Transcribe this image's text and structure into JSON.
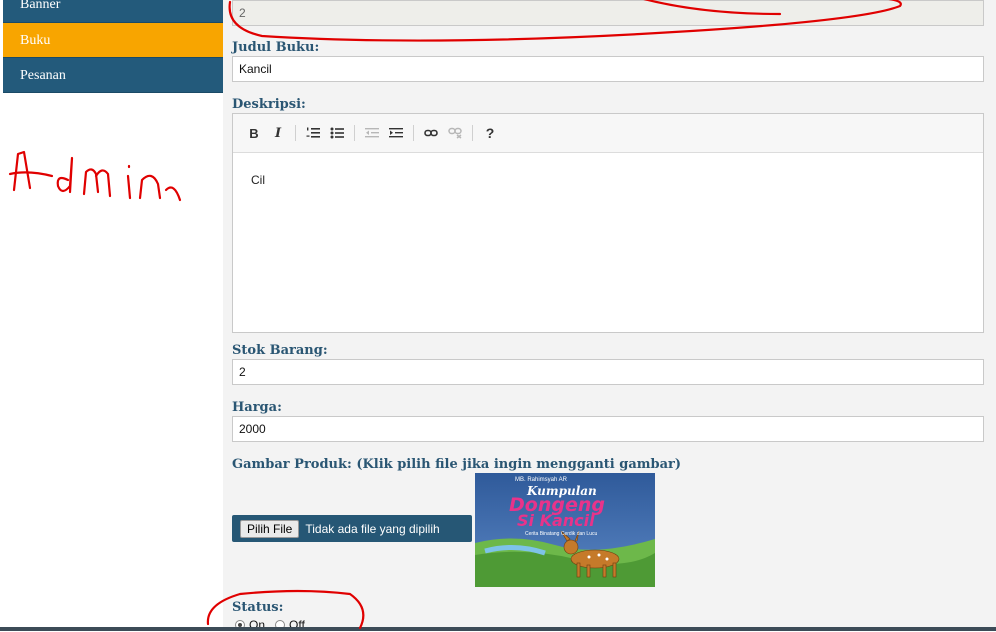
{
  "sidebar": {
    "items": [
      {
        "label": "Banner"
      },
      {
        "label": "Buku"
      },
      {
        "label": "Pesanan"
      }
    ]
  },
  "annotations": {
    "admin_text": "Admin"
  },
  "form": {
    "id_value": "2",
    "judul_label": "Judul Buku:",
    "judul_value": "Kancil",
    "deskripsi_label": "Deskripsi:",
    "deskripsi_value": "Cil",
    "stok_label": "Stok Barang:",
    "stok_value": "2",
    "harga_label": "Harga:",
    "harga_value": "2000",
    "gambar_label": "Gambar Produk: (Klik pilih file jika ingin mengganti gambar)",
    "file_button": "Pilih File",
    "file_status": "Tidak ada file yang dipilih",
    "status_label": "Status:",
    "status_on": "On",
    "status_off": "Off"
  },
  "toolbar": {
    "bold": "B",
    "italic": "I",
    "help": "?"
  },
  "cover": {
    "author": "MB. Rahimsyah AR",
    "title_line1": "Kumpulan",
    "title_line2": "Dongeng",
    "title_line3": "Si Kancil",
    "subtitle": "Cerita Binatang Cerdik dan Lucu"
  },
  "colors": {
    "sidebar_dark": "#235a7b",
    "sidebar_active": "#f8a500",
    "label": "#2a5673",
    "annotation": "#e00000"
  }
}
